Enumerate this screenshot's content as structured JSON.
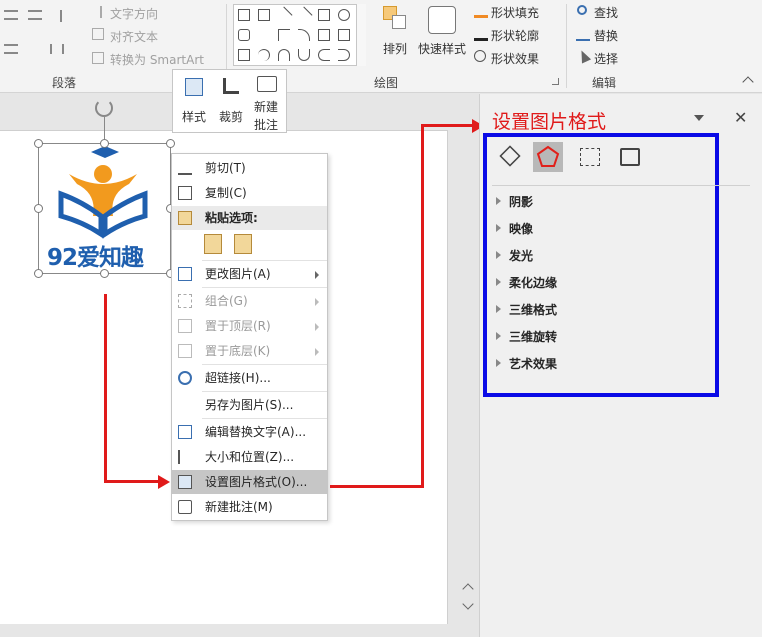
{
  "ribbon": {
    "para_group_label": "段落",
    "draw_group_label": "绘图",
    "edit_group_label": "编辑",
    "text_direction": "文字方向",
    "align_text": "对齐文本",
    "convert_smartart": "转换为 SmartArt",
    "arrange": "排列",
    "quick_styles": "快速样式",
    "shape_fill": "形状填充",
    "shape_outline": "形状轮廓",
    "shape_effects": "形状效果",
    "find": "查找",
    "replace": "替换",
    "select": "选择"
  },
  "mini_toolbar": {
    "style": "样式",
    "crop": "裁剪",
    "new_comment_line1": "新建",
    "new_comment_line2": "批注"
  },
  "logo": {
    "text": "92爱知趣"
  },
  "context_menu": {
    "cut": "剪切(T)",
    "copy": "复制(C)",
    "paste_options": "粘贴选项:",
    "change_picture": "更改图片(A)",
    "group": "组合(G)",
    "bring_front": "置于顶层(R)",
    "send_back": "置于底层(K)",
    "hyperlink": "超链接(H)...",
    "save_as_picture": "另存为图片(S)...",
    "edit_alt_text": "编辑替换文字(A)...",
    "size_position": "大小和位置(Z)...",
    "format_picture": "设置图片格式(O)...",
    "new_comment": "新建批注(M)"
  },
  "panel": {
    "title": "设置图片格式",
    "sections": [
      "阴影",
      "映像",
      "发光",
      "柔化边缘",
      "三维格式",
      "三维旋转",
      "艺术效果"
    ]
  },
  "colors": {
    "annotation_red": "#e01a1a",
    "highlight_blue": "#0a0ae6",
    "logo_blue": "#1f5fae",
    "logo_orange": "#f29a1e"
  }
}
